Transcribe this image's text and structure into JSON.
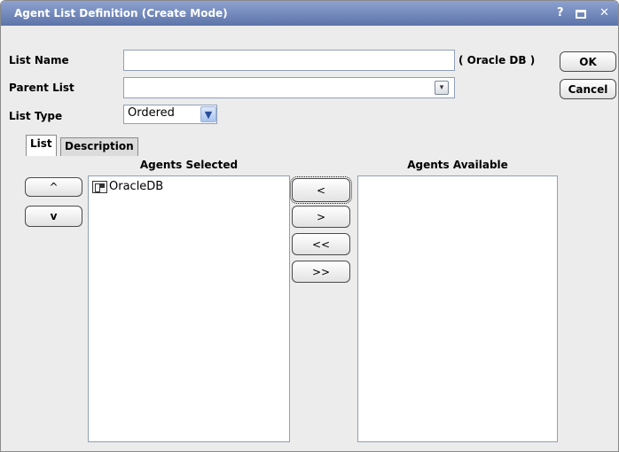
{
  "window": {
    "title": "Agent List Definition (Create Mode)",
    "help_label": "?",
    "close_label": "✕"
  },
  "form": {
    "list_name_label": "List Name",
    "list_name_value": "",
    "db_tag": "( Oracle DB )",
    "parent_list_label": "Parent List",
    "parent_list_value": "",
    "list_type_label": "List Type",
    "list_type_value": "Ordered"
  },
  "buttons": {
    "ok": "OK",
    "cancel": "Cancel",
    "move_up": "^",
    "move_down": "v",
    "add_one": "<",
    "remove_one": ">",
    "add_all": "<<",
    "remove_all": ">>"
  },
  "tabs": [
    {
      "label": "List",
      "active": true
    },
    {
      "label": "Description",
      "active": false
    }
  ],
  "agents_selected": {
    "header": "Agents Selected",
    "items": [
      {
        "label": "OracleDB",
        "icon": "agent-icon"
      }
    ]
  },
  "agents_available": {
    "header": "Agents Available",
    "items": []
  },
  "colors": {
    "titlebar_top": "#8da2cf",
    "titlebar_bottom": "#5d74aa",
    "dialog_bg": "#ececec",
    "field_border": "#8fa0b8"
  }
}
